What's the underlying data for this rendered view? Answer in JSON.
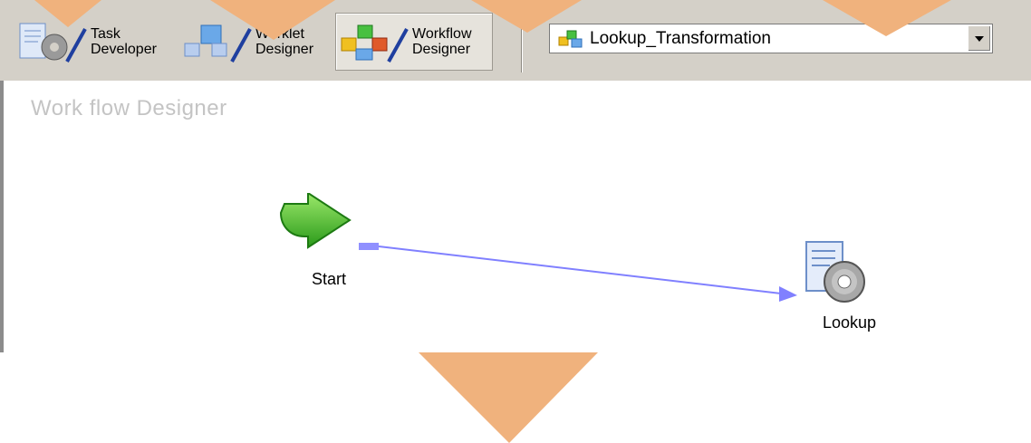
{
  "toolbar": {
    "task_developer": {
      "line1": "Task",
      "line2": "Developer"
    },
    "worklet_designer": {
      "line1": "Worklet",
      "line2": "Designer"
    },
    "workflow_designer": {
      "line1": "Workflow",
      "line2": "Designer"
    },
    "workflow_select": {
      "value": "Lookup_Transformation"
    }
  },
  "canvas": {
    "title": "Work flow Designer",
    "tasks": [
      {
        "label": "Start",
        "icon": "start-arrow-icon"
      },
      {
        "label": "Lookup",
        "icon": "session-gear-icon"
      }
    ],
    "link_color": "#8080ff"
  },
  "decorations": {
    "overlay_color": "#f0b27d"
  }
}
